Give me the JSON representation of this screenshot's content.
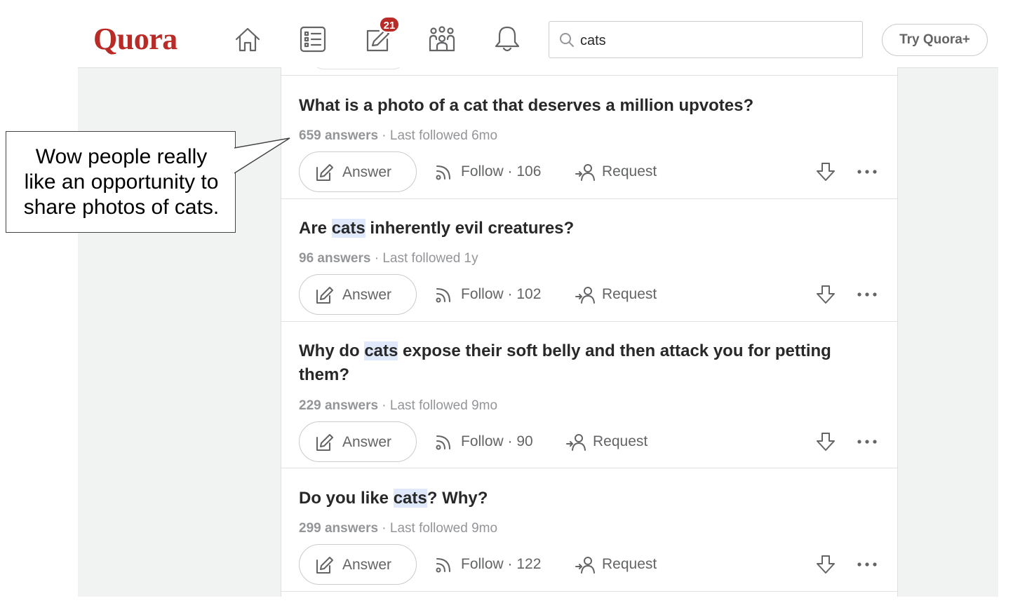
{
  "header": {
    "logo": "Quora",
    "notification_badge": "21",
    "search_value": "cats",
    "try_button": "Try Quora+",
    "icons": [
      "home-icon",
      "answer-list-icon",
      "write-icon",
      "spaces-icon",
      "bell-icon",
      "search-icon"
    ]
  },
  "callout": {
    "line1": "Wow people really",
    "line2": "like an opportunity to",
    "line3": "share photos of cats."
  },
  "questions": [
    {
      "title_pre": "What is a photo of a cat that deserves a million upvotes?",
      "title_hl": "",
      "title_post": "",
      "answers": "659 answers",
      "last_followed": " · Last followed 6mo",
      "answer_label": "Answer",
      "follow_label": "Follow",
      "follow_count": " · 106",
      "request_label": "Request"
    },
    {
      "title_pre": "Are ",
      "title_hl": "cats",
      "title_post": " inherently evil creatures?",
      "answers": "96 answers",
      "last_followed": " · Last followed 1y",
      "answer_label": "Answer",
      "follow_label": "Follow",
      "follow_count": " · 102",
      "request_label": "Request"
    },
    {
      "title_pre": "Why do ",
      "title_hl": "cats",
      "title_post": " expose their soft belly and then attack you for petting them?",
      "answers": "229 answers",
      "last_followed": " · Last followed 9mo",
      "answer_label": "Answer",
      "follow_label": "Follow",
      "follow_count": " · 90",
      "request_label": "Request"
    },
    {
      "title_pre": "Do you like ",
      "title_hl": "cats",
      "title_post": "? Why?",
      "answers": "299 answers",
      "last_followed": " · Last followed 9mo",
      "answer_label": "Answer",
      "follow_label": "Follow",
      "follow_count": " · 122",
      "request_label": "Request"
    }
  ],
  "colors": {
    "brand": "#b92b27",
    "highlight": "#e0e8fb",
    "muted_text": "#939598",
    "background": "#f1f2f2"
  }
}
